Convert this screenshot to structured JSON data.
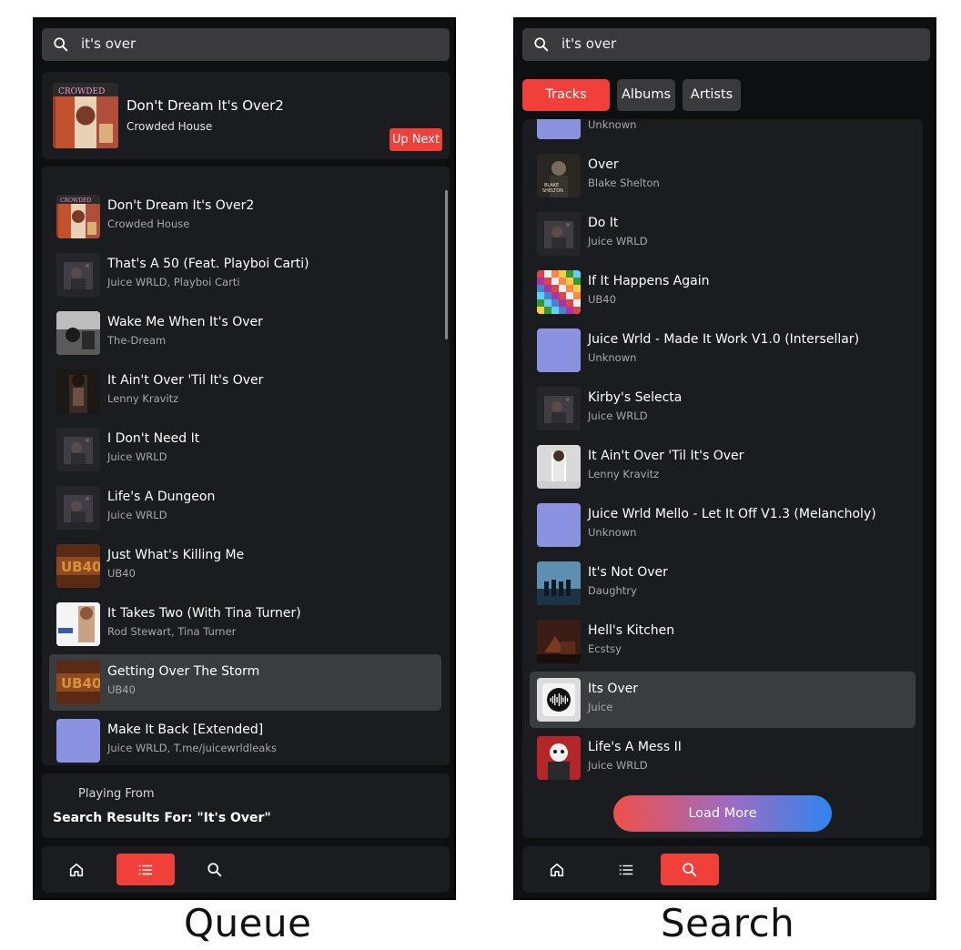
{
  "queue_screen": {
    "search": {
      "query": "it's over"
    },
    "now_playing": {
      "title": "Don't Dream It's Over2",
      "artist": "Crowded House",
      "up_next_label": "Up Next",
      "art": "crowded-house-cover"
    },
    "items": [
      {
        "title": "Don't Dream It's Over2",
        "artist": "Crowded House",
        "art": "crowded-house-cover"
      },
      {
        "title": "That's A 50 (Feat. Playboi Carti)",
        "artist": "Juice WRLD, Playboi Carti",
        "art": "dark-cover"
      },
      {
        "title": "Wake Me When It's Over",
        "artist": "The-Dream",
        "art": "bw-cover"
      },
      {
        "title": "It Ain't Over 'Til It's Over",
        "artist": "Lenny Kravitz",
        "art": "kravitz-cover"
      },
      {
        "title": "I Don't Need It",
        "artist": "Juice WRLD",
        "art": "dark-cover"
      },
      {
        "title": "Life's A Dungeon",
        "artist": "Juice WRLD",
        "art": "dark-cover"
      },
      {
        "title": "Just What's Killing Me",
        "artist": "UB40",
        "art": "ub40-cover"
      },
      {
        "title": "It Takes Two (With Tina Turner)",
        "artist": "Rod Stewart, Tina Turner",
        "art": "tina-cover"
      },
      {
        "title": "Getting Over The Storm",
        "artist": "UB40",
        "art": "ub40-cover",
        "active": true
      },
      {
        "title": "Make It Back [Extended]",
        "artist": "Juice WRLD, T.me/juicewrldleaks",
        "art": "placeholder"
      }
    ],
    "playing_from": {
      "label": "Playing From",
      "value": "Search Results For: \"It's Over\""
    },
    "nav": {
      "selected": "queue"
    },
    "caption": "Queue"
  },
  "search_screen": {
    "search": {
      "query": "it's over"
    },
    "tabs": [
      {
        "label": "Tracks",
        "selected": true
      },
      {
        "label": "Albums",
        "selected": false
      },
      {
        "label": "Artists",
        "selected": false
      }
    ],
    "results": [
      {
        "title": "",
        "artist": "Unknown",
        "art": "placeholder"
      },
      {
        "title": "Over",
        "artist": "Blake Shelton",
        "art": "blake-cover"
      },
      {
        "title": "Do It",
        "artist": "Juice WRLD",
        "art": "dark-cover"
      },
      {
        "title": "If It Happens Again",
        "artist": "UB40",
        "art": "mosaic-cover"
      },
      {
        "title": "Juice Wrld - Made It Work V1.0 (Intersellar)",
        "artist": "Unknown",
        "art": "placeholder"
      },
      {
        "title": "Kirby's Selecta",
        "artist": "Juice WRLD",
        "art": "dark-cover"
      },
      {
        "title": "It Ain't Over 'Til It's Over",
        "artist": "Lenny Kravitz",
        "art": "kravitz-light-cover"
      },
      {
        "title": "Juice Wrld Mello - Let It Off V1.3 (Melancholy)",
        "artist": "Unknown",
        "art": "placeholder"
      },
      {
        "title": "It's Not Over",
        "artist": "Daughtry",
        "art": "daughtry-cover"
      },
      {
        "title": "Hell's Kitchen",
        "artist": "Ecstsy",
        "art": "hells-cover"
      },
      {
        "title": "Its Over",
        "artist": "Juice",
        "art": "waveform-cover",
        "active": true
      },
      {
        "title": "Life's A Mess II",
        "artist": "Juice WRLD",
        "art": "mess-cover"
      }
    ],
    "load_more_label": "Load More",
    "nav": {
      "selected": "search"
    },
    "caption": "Search"
  },
  "icons": [
    "search-icon",
    "home-icon",
    "list-icon"
  ],
  "colors": {
    "accent": "#f1403a",
    "background": "#0e0f11",
    "panel": "#1b1c20",
    "placeholder_art": "#8b92e0"
  }
}
